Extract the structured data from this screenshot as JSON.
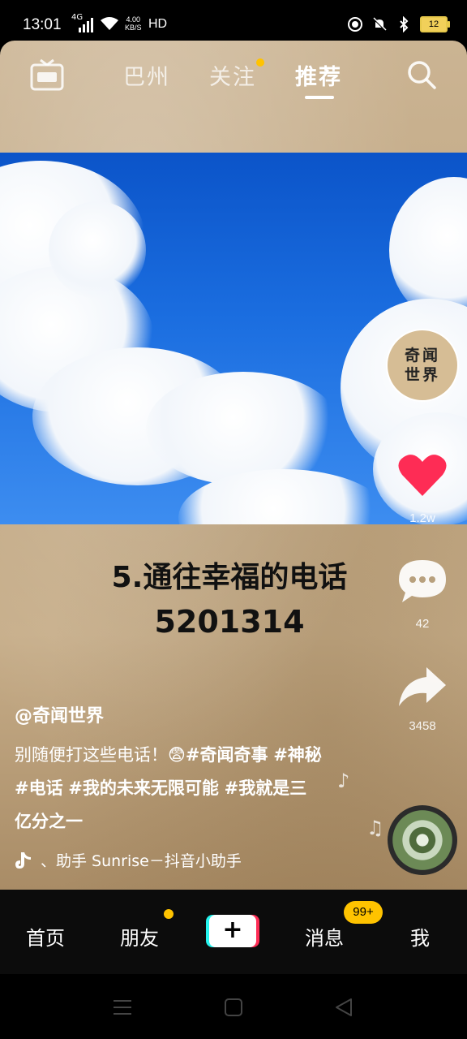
{
  "status_bar": {
    "time": "13:01",
    "network_type": "4G",
    "speed_value": "4.00",
    "speed_unit": "KB/S",
    "hd_label": "HD",
    "battery": "12"
  },
  "top_nav": {
    "tabs": [
      {
        "label": "巴州",
        "active": false
      },
      {
        "label": "关注",
        "active": false,
        "has_dot": true
      },
      {
        "label": "推荐",
        "active": true
      }
    ]
  },
  "video": {
    "caption_line1": "5.通往幸福的电话",
    "caption_line2": "5201314",
    "avatar_text_line1": "奇闻",
    "avatar_text_line2": "世界",
    "like_count": "1.2w",
    "comment_count": "42",
    "share_count": "3458",
    "author": "@奇闻世界",
    "desc_text": "别随便打这些电话！😨",
    "hashtags": [
      "#奇闻奇事",
      "#神秘",
      "#电话",
      "#我的未来无限可能",
      "#我就是三亿分之一"
    ],
    "music_text": "、助手  Sunrise－抖音小助手"
  },
  "bottom_nav": {
    "items": [
      "首页",
      "朋友",
      "消息",
      "我"
    ],
    "message_badge": "99+"
  },
  "colors": {
    "like_red": "#fe2c55",
    "badge_yellow": "#ffc300",
    "accent_cyan": "#25f4ee"
  }
}
